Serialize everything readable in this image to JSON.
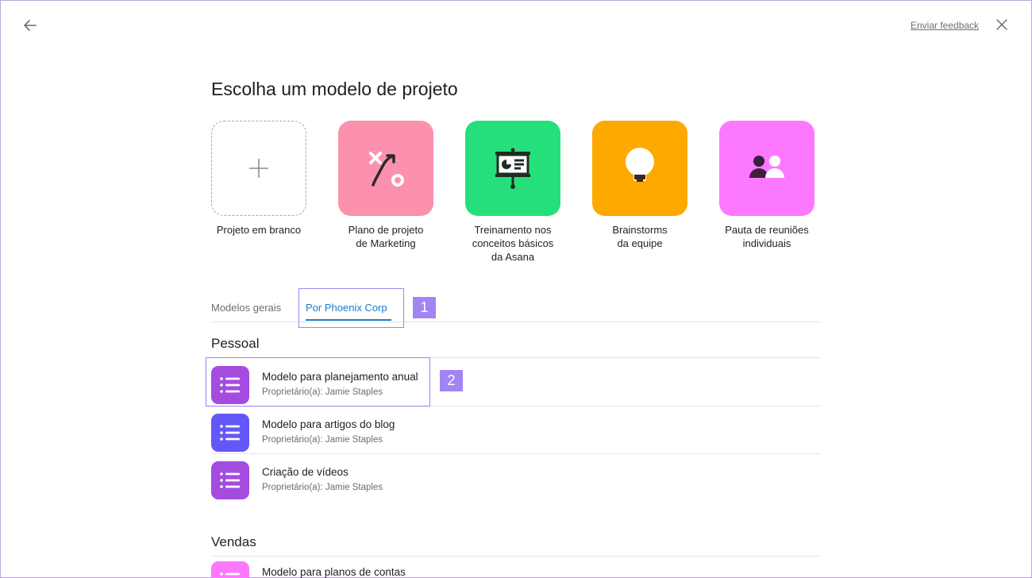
{
  "header": {
    "back_icon": "arrow-left-icon",
    "feedback_label": "Enviar feedback",
    "close_icon": "close-icon"
  },
  "page_title": "Escolha um modelo de projeto",
  "tiles": [
    {
      "label": "Projeto em branco",
      "icon": "plus-icon",
      "color": "#ffffff"
    },
    {
      "label": "Plano de projeto\nde Marketing",
      "icon": "strategy-path-icon",
      "color": "#fc91ad"
    },
    {
      "label": "Treinamento nos\nconceitos básicos\nda Asana",
      "icon": "presentation-board-icon",
      "color": "#25e07a"
    },
    {
      "label": "Brainstorms\nda equipe",
      "icon": "lightbulb-icon",
      "color": "#fda900"
    },
    {
      "label": "Pauta de reuniões\nindividuais",
      "icon": "two-people-icon",
      "color": "#fc79ff"
    }
  ],
  "tabs": [
    {
      "label": "Modelos gerais",
      "active": false
    },
    {
      "label": "Por Phoenix Corp",
      "active": true
    }
  ],
  "callouts": [
    "1",
    "2"
  ],
  "sections": [
    {
      "title": "Pessoal",
      "items": [
        {
          "name": "Modelo para planejamento anual",
          "owner": "Proprietário(a): Jamie Staples",
          "color": "#a34cdf",
          "icon": "list-icon"
        },
        {
          "name": "Modelo para artigos do blog",
          "owner": "Proprietário(a): Jamie Staples",
          "color": "#6457f9",
          "icon": "list-icon"
        },
        {
          "name": "Criação de vídeos",
          "owner": "Proprietário(a): Jamie Staples",
          "color": "#a34cdf",
          "icon": "list-icon"
        }
      ]
    },
    {
      "title": "Vendas",
      "items": [
        {
          "name": "Modelo para planos de contas",
          "owner": "",
          "color": "#fc79ff",
          "icon": "list-icon"
        }
      ]
    }
  ],
  "colors": {
    "accent": "#1a7bd0",
    "callout": "#a185f5"
  }
}
